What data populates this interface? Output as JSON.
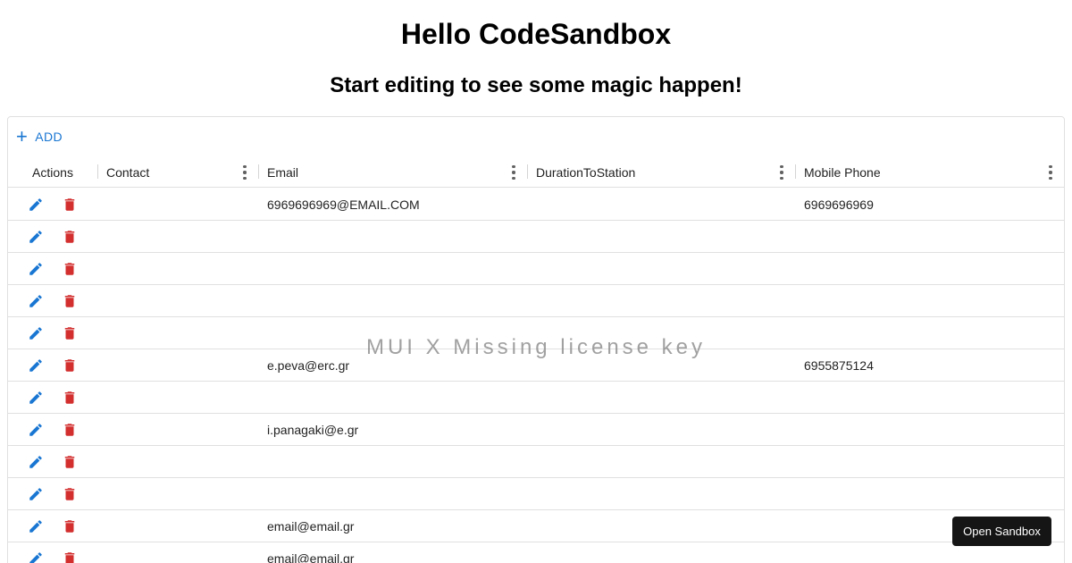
{
  "page": {
    "title": "Hello CodeSandbox",
    "subtitle": "Start editing to see some magic happen!"
  },
  "toolbar": {
    "add_label": "ADD"
  },
  "columns": [
    {
      "label": "Actions"
    },
    {
      "label": "Contact"
    },
    {
      "label": "Email"
    },
    {
      "label": "DurationToStation"
    },
    {
      "label": "Mobile Phone"
    }
  ],
  "rows": [
    {
      "contact": "",
      "email": "6969696969@EMAIL.COM",
      "duration": "",
      "mobile": "6969696969"
    },
    {
      "contact": "",
      "email": "",
      "duration": "",
      "mobile": ""
    },
    {
      "contact": "",
      "email": "",
      "duration": "",
      "mobile": ""
    },
    {
      "contact": "",
      "email": "",
      "duration": "",
      "mobile": ""
    },
    {
      "contact": "",
      "email": "",
      "duration": "",
      "mobile": ""
    },
    {
      "contact": "",
      "email": "e.peva@erc.gr",
      "duration": "",
      "mobile": "6955875124"
    },
    {
      "contact": "",
      "email": "",
      "duration": "",
      "mobile": ""
    },
    {
      "contact": "",
      "email": "i.panagaki@e.gr",
      "duration": "",
      "mobile": ""
    },
    {
      "contact": "",
      "email": "",
      "duration": "",
      "mobile": ""
    },
    {
      "contact": "",
      "email": "",
      "duration": "",
      "mobile": ""
    },
    {
      "contact": "",
      "email": "email@email.gr",
      "duration": "",
      "mobile": ""
    },
    {
      "contact": "",
      "email": "email@email.gr",
      "duration": "",
      "mobile": ""
    }
  ],
  "watermark": "MUI X Missing license key",
  "open_sandbox_label": "Open Sandbox",
  "icons": {
    "add": "plus-icon",
    "edit": "pencil-icon",
    "delete": "trash-icon",
    "column_menu": "more-vert-icon"
  },
  "colors": {
    "primary": "#1976d2",
    "danger": "#d32f2f",
    "border": "#e0e0e0"
  }
}
